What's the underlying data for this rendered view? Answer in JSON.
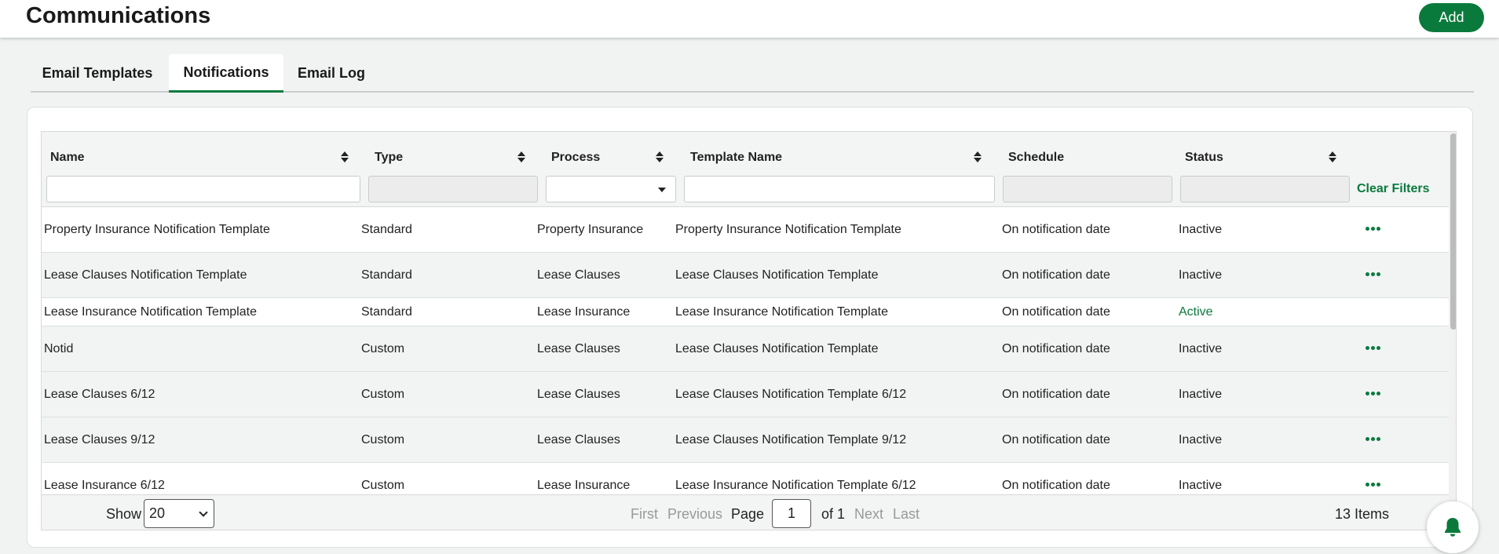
{
  "header": {
    "title": "Communications",
    "add_label": "Add"
  },
  "tabs": [
    {
      "label": "Email Templates",
      "active": false
    },
    {
      "label": "Notifications",
      "active": true
    },
    {
      "label": "Email Log",
      "active": false
    }
  ],
  "table": {
    "columns": [
      "Name",
      "Type",
      "Process",
      "Template Name",
      "Schedule",
      "Status"
    ],
    "clear_filters_label": "Clear Filters",
    "rows": [
      {
        "name": "Property Insurance Notification Template",
        "type": "Standard",
        "process": "Property Insurance",
        "template": "Property Insurance Notification Template",
        "schedule": "On notification date",
        "status": "Inactive",
        "has_menu": true
      },
      {
        "name": "Lease Clauses Notification Template",
        "type": "Standard",
        "process": "Lease Clauses",
        "template": "Lease Clauses Notification Template",
        "schedule": "On notification date",
        "status": "Inactive",
        "has_menu": true
      },
      {
        "name": "Lease Insurance Notification Template",
        "type": "Standard",
        "process": "Lease Insurance",
        "template": "Lease Insurance Notification Template",
        "schedule": "On notification date",
        "status": "Active",
        "has_menu": false
      },
      {
        "name": "Notid",
        "type": "Custom",
        "process": "Lease Clauses",
        "template": "Lease Clauses Notification Template",
        "schedule": "On notification date",
        "status": "Inactive",
        "has_menu": true
      },
      {
        "name": "Lease Clauses 6/12",
        "type": "Custom",
        "process": "Lease Clauses",
        "template": "Lease Clauses Notification Template 6/12",
        "schedule": "On notification date",
        "status": "Inactive",
        "has_menu": true
      },
      {
        "name": "Lease Clauses 9/12",
        "type": "Custom",
        "process": "Lease Clauses",
        "template": "Lease Clauses Notification Template 9/12",
        "schedule": "On notification date",
        "status": "Inactive",
        "has_menu": true
      },
      {
        "name": "Lease Insurance 6/12",
        "type": "Custom",
        "process": "Lease Insurance",
        "template": "Lease Insurance Notification Template 6/12",
        "schedule": "On notification date",
        "status": "Inactive",
        "has_menu": true
      }
    ]
  },
  "pagination": {
    "show_label": "Show",
    "page_size": "20",
    "first": "First",
    "previous": "Previous",
    "page_label": "Page",
    "page": "1",
    "of_label": "of 1",
    "next": "Next",
    "last": "Last",
    "items_label": "13 Items"
  },
  "colors": {
    "accent": "#0a7a3c",
    "active_status": "#0a7a3c"
  },
  "icons": {
    "sort": "sort-icon",
    "row_menu": "more-horizontal-icon",
    "notifications": "bell-icon"
  }
}
